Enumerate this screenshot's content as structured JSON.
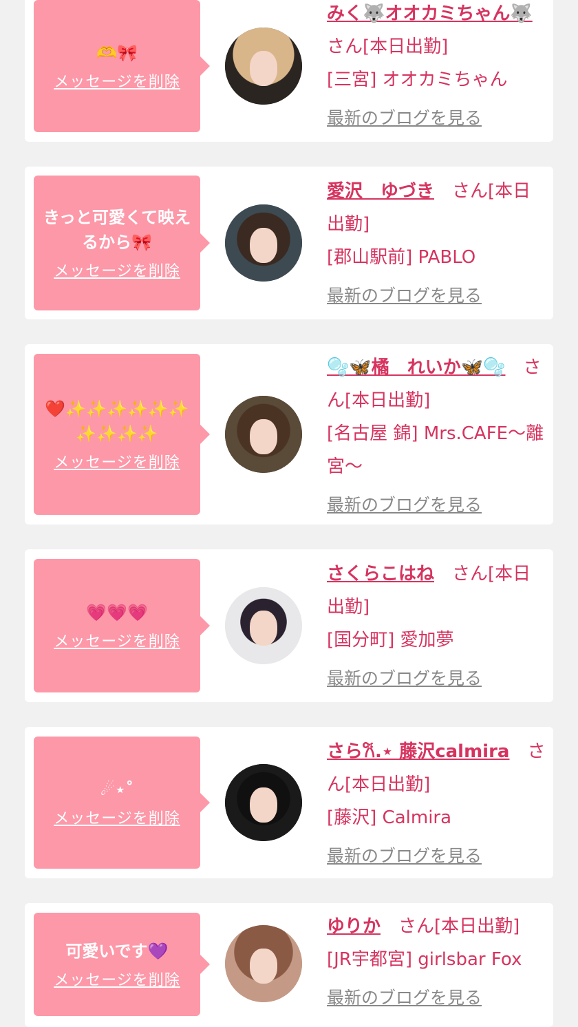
{
  "cards": [
    {
      "message": "🫶🎀",
      "delete_label": "メッセージを削除",
      "name": "みく🐺オオカミちゃん🐺",
      "suffix": "さん[本日出勤]",
      "shop": "[三宮] オオカミちゃん",
      "blog_link": "最新のブログを見る",
      "avatar_colors": {
        "bg": "#2a2520",
        "hair": "#d9b58a"
      }
    },
    {
      "message": "きっと可愛くて映えるから🎀",
      "delete_label": "メッセージを削除",
      "name": "愛沢　ゆづき",
      "suffix": "さん[本日出勤]",
      "shop": "[郡山駅前] PABLO",
      "blog_link": "最新のブログを見る",
      "avatar_colors": {
        "bg": "#3d4a52",
        "hair": "#3a2a22"
      }
    },
    {
      "message": "❤️✨✨✨✨✨✨✨✨✨✨",
      "delete_label": "メッセージを削除",
      "name": "🫧🦋橘　れいか🦋🫧",
      "suffix": "さん[本日出勤]",
      "shop": "[名古屋 錦] Mrs.CAFE～離宮～",
      "blog_link": "最新のブログを見る",
      "avatar_colors": {
        "bg": "#5a4a38",
        "hair": "#4b3324"
      }
    },
    {
      "message": "💗💗💗",
      "delete_label": "メッセージを削除",
      "name": "さくらこはね",
      "suffix": "さん[本日出勤]",
      "shop": "[国分町] 愛加夢",
      "blog_link": "最新のブログを見る",
      "avatar_colors": {
        "bg": "#e8e8ea",
        "hair": "#2b2230"
      }
    },
    {
      "message": "☄︎⋆˚",
      "delete_label": "メッセージを削除",
      "name": "さら𐙚.⋆ 藤沢calmira",
      "suffix": "さん[本日出勤]",
      "shop": "[藤沢] Calmira",
      "blog_link": "最新のブログを見る",
      "avatar_colors": {
        "bg": "#1a1a1a",
        "hair": "#101010"
      }
    },
    {
      "message": "可愛いです💜",
      "delete_label": "メッセージを削除",
      "name": "ゆりか",
      "suffix": "さん[本日出勤]",
      "shop": "[JR宇都宮] girlsbar Fox",
      "blog_link": "最新のブログを見る",
      "avatar_colors": {
        "bg": "#c49a86",
        "hair": "#8a5a44"
      }
    }
  ]
}
